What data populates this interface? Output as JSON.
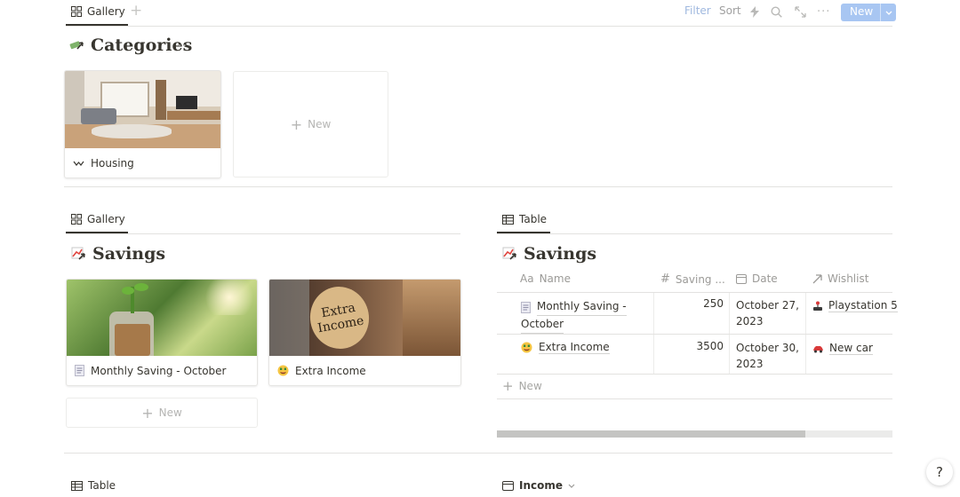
{
  "top_bar": {
    "tab_label": "Gallery",
    "add_tab": "+",
    "filter": "Filter",
    "sort": "Sort",
    "new_button": "New",
    "new_caret": "v",
    "more": "..."
  },
  "categories": {
    "title": "Categories",
    "more": "...",
    "cards": [
      {
        "title": "Housing"
      }
    ],
    "new_card": "New"
  },
  "savings_gallery": {
    "tab_label": "Gallery",
    "title": "Savings",
    "cards": [
      {
        "title": "Monthly Saving - October",
        "icon": "receipt-icon"
      },
      {
        "title": "Extra Income",
        "icon": "money-face-icon",
        "image_text_line1": "Extra",
        "image_text_line2": "Income"
      }
    ],
    "new_card": "New"
  },
  "savings_table": {
    "tab_label": "Table",
    "title": "Savings",
    "columns": [
      {
        "label": "Name",
        "prefix": "Aa"
      },
      {
        "label": "Saving ...",
        "prefix": "#"
      },
      {
        "label": "Date"
      },
      {
        "label": "Wishlist"
      }
    ],
    "rows": [
      {
        "name_line1": "Monthly Saving -",
        "name_line2": "October",
        "saving": "250",
        "date_line1": "October 27,",
        "date_line2": "2023",
        "wishlist": "Playstation 5"
      },
      {
        "name_line1": "Extra Income",
        "name_line2": "",
        "saving": "3500",
        "date_line1": "October 30,",
        "date_line2": "2023",
        "wishlist": "New car"
      }
    ],
    "new_row": "New"
  },
  "bottom": {
    "table_tab": "Table",
    "income_tab": "Income",
    "help": "?"
  },
  "colors": {
    "text": "#37352f",
    "muted": "#9b9a97",
    "new_button": "#a8c6f2"
  }
}
